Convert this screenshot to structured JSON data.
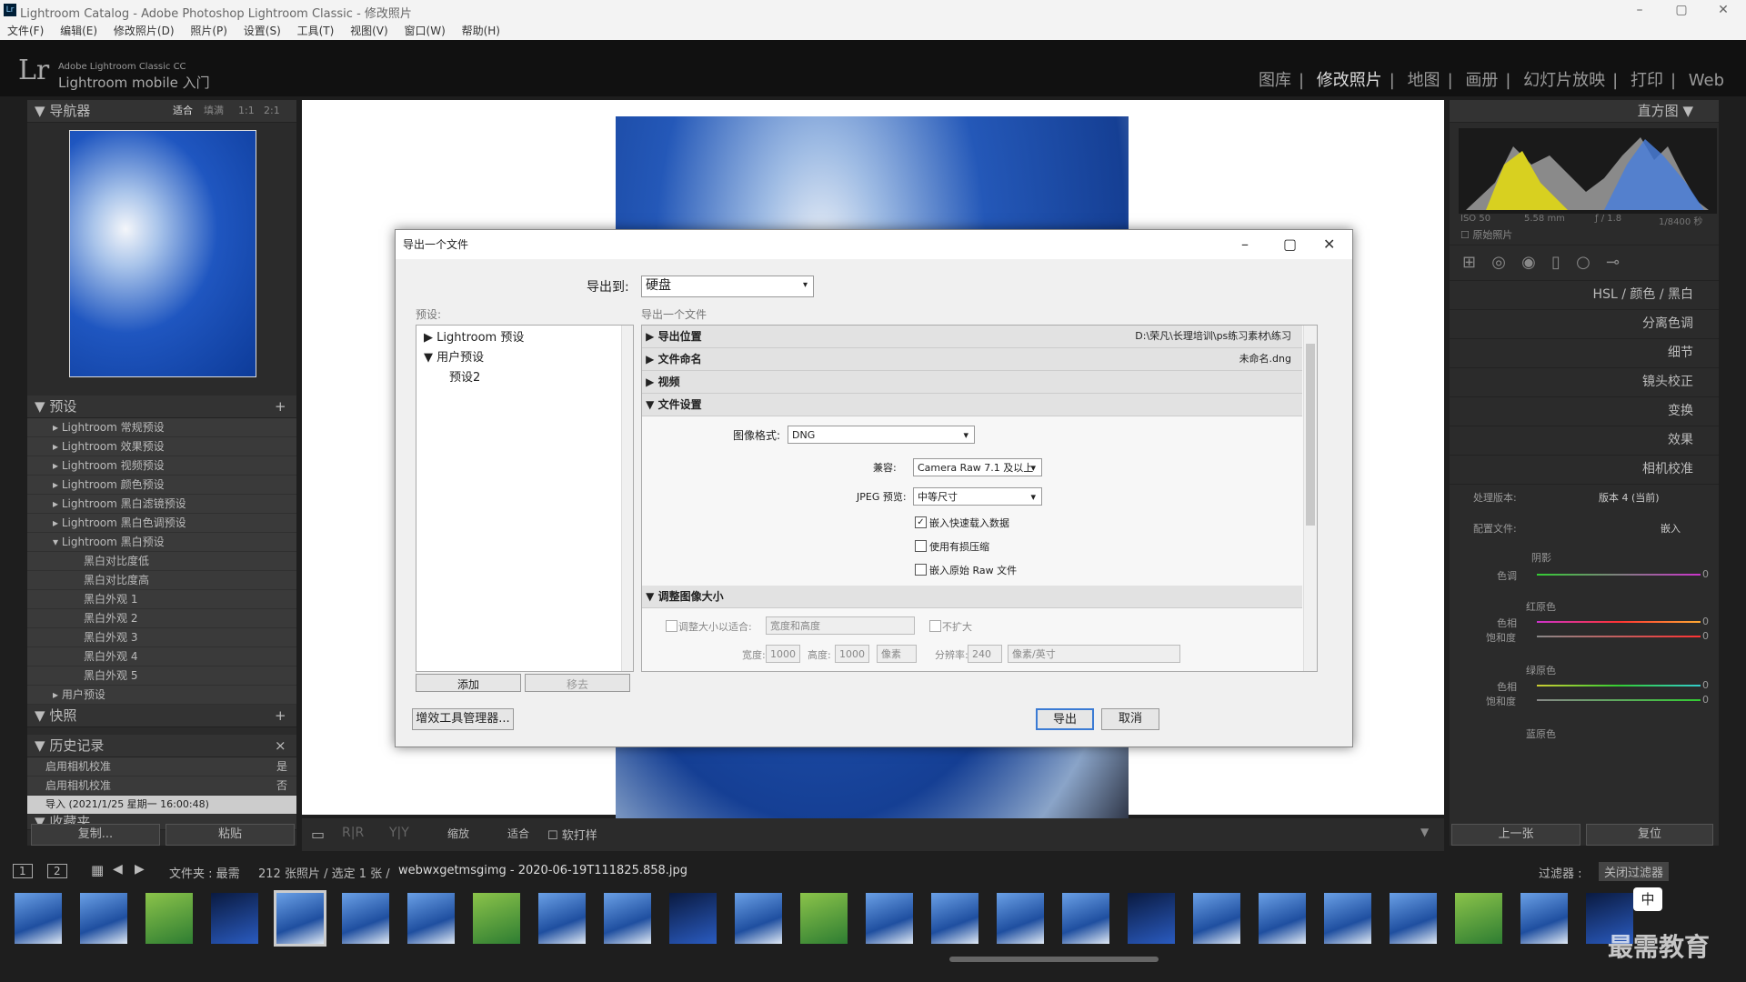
{
  "window": {
    "title": "Lightroom Catalog - Adobe Photoshop Lightroom Classic - 修改照片",
    "app_icon": "Lr",
    "controls": [
      "–",
      "▢",
      "✕"
    ]
  },
  "menubar": [
    "文件(F)",
    "编辑(E)",
    "修改照片(D)",
    "照片(P)",
    "设置(S)",
    "工具(T)",
    "视图(V)",
    "窗口(W)",
    "帮助(H)"
  ],
  "topbar": {
    "logo": "Lr",
    "brand_line1": "Adobe Lightroom Classic CC",
    "brand_line2": "Lightroom mobile 入门",
    "modules": [
      "图库",
      "修改照片",
      "地图",
      "画册",
      "幻灯片放映",
      "打印",
      "Web"
    ],
    "active_module": 1
  },
  "left_panel": {
    "navigator": {
      "title": "导航器",
      "zoom_options": [
        "适合",
        "填满",
        "1:1",
        "2:1"
      ]
    },
    "presets": {
      "title": "预设",
      "items": [
        "Lightroom 常规预设",
        "Lightroom 效果预设",
        "Lightroom 视频预设",
        "Lightroom 颜色预设",
        "Lightroom 黑白滤镜预设",
        "Lightroom 黑白色调预设",
        "Lightroom 黑白预设"
      ],
      "subitems": [
        "黑白对比度低",
        "黑白对比度高",
        "黑白外观 1",
        "黑白外观 2",
        "黑白外观 3",
        "黑白外观 4",
        "黑白外观 5"
      ],
      "user": "用户预设"
    },
    "snapshots": {
      "title": "快照"
    },
    "history": {
      "title": "历史记录",
      "rows": [
        {
          "label": "启用相机校准",
          "val": "是"
        },
        {
          "label": "启用相机校准",
          "val": "否"
        },
        {
          "label": "导入 (2021/1/25 星期一 16:00:48)",
          "val": ""
        }
      ]
    },
    "collections": {
      "title": "收藏夹"
    },
    "copy": "复制...",
    "paste": "粘贴"
  },
  "right_panel": {
    "histogram": {
      "title": "直方图",
      "iso": "ISO 50",
      "focal": "5.58 mm",
      "aperture": "ƒ / 1.8",
      "shutter": "1/8400 秒",
      "original": "原始照片"
    },
    "sections": [
      "HSL / 颜色 / 黑白",
      "分离色调",
      "细节",
      "镜头校正",
      "变换",
      "效果",
      "相机校准"
    ],
    "process_label": "处理版本:",
    "process_value": "版本 4 (当前)",
    "profile_label": "配置文件:",
    "profile_value": "嵌入",
    "shadow_title": "阴影",
    "tint": "色调",
    "red": "红原色",
    "green": "绿原色",
    "blue": "蓝原色",
    "hue": "色相",
    "sat": "饱和度",
    "zero": "0",
    "prev": "上一张",
    "reset": "复位"
  },
  "toolbar": {
    "zoom": "缩放",
    "fit": "适合",
    "proof": "软打样"
  },
  "filmstrip": {
    "pages": [
      "1",
      "2"
    ],
    "folder": "文件夹 : 最需",
    "info": "212 张照片 / 选定 1 张 /",
    "filename": "webwxgetmsgimg - 2020-06-19T111825.858.jpg",
    "filter_label": "过滤器 :",
    "filter_value": "关闭过滤器"
  },
  "dialog": {
    "title": "导出一个文件",
    "export_to_label": "导出到:",
    "export_to_value": "硬盘",
    "preset_label": "预设:",
    "export_label": "导出一个文件",
    "tree": [
      "Lightroom 预设",
      "用户预设",
      "预设2"
    ],
    "add": "添加",
    "remove": "移去",
    "sections": [
      {
        "label": "导出位置",
        "detail": "D:\\荣凡\\长理培训\\ps练习素材\\练习"
      },
      {
        "label": "文件命名",
        "detail": "未命名.dng"
      },
      {
        "label": "视频",
        "detail": ""
      },
      {
        "label": "文件设置",
        "detail": ""
      }
    ],
    "format_label": "图像格式:",
    "format_value": "DNG",
    "compat_label": "兼容:",
    "compat_value": "Camera Raw 7.1 及以上",
    "jpeg_label": "JPEG 预览:",
    "jpeg_value": "中等尺寸",
    "checks": [
      {
        "label": "嵌入快速载入数据",
        "checked": true
      },
      {
        "label": "使用有损压缩",
        "checked": false
      },
      {
        "label": "嵌入原始 Raw 文件",
        "checked": false
      }
    ],
    "resize": {
      "title": "调整图像大小",
      "fit_label": "调整大小以适合:",
      "fit_value": "宽度和高度",
      "no_enlarge": "不扩大",
      "w_label": "宽度:",
      "w": "1000",
      "h_label": "高度:",
      "h": "1000",
      "unit": "像素",
      "res_label": "分辨率:",
      "res": "240",
      "res_unit": "像素/英寸"
    },
    "plugin_btn": "增效工具管理器...",
    "export_btn": "导出",
    "cancel_btn": "取消"
  },
  "watermark": "最需教育",
  "ime": "中"
}
